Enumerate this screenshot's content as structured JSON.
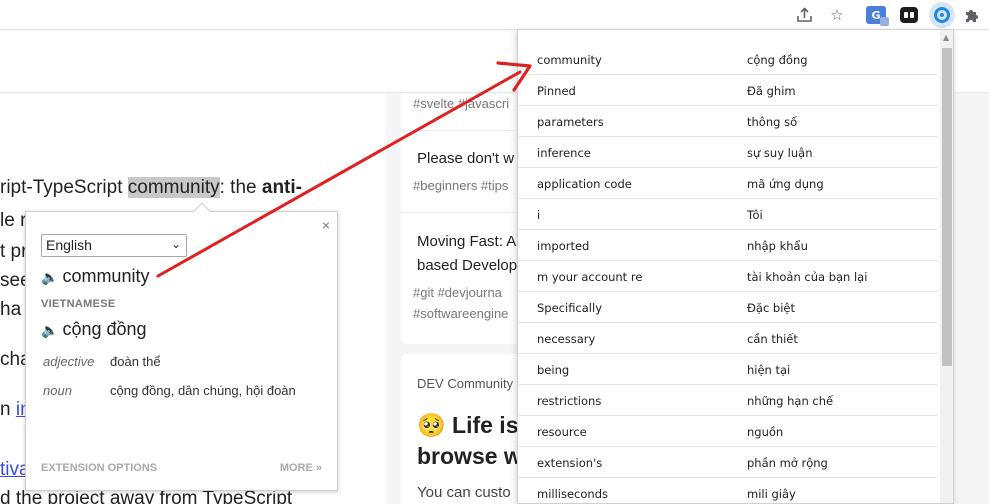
{
  "toolbar": {
    "icons": [
      "share-icon",
      "star-icon",
      "google-translate-icon",
      "extension-icon",
      "vocab-extension-icon",
      "puzzle-icon"
    ]
  },
  "article": {
    "line1": {
      "before": "ript-TypeScript ",
      "highlight": "community",
      "middle": ": the ",
      "bold": "anti-"
    },
    "line2": "le r",
    "line3": "t pr",
    "line4": "see",
    "line5": "ha",
    "line6": "cha",
    "line7_a": "n ",
    "line7_link": "in",
    "line8_link": "tiva",
    "line9": "d the project away from TypeScript"
  },
  "sidebar": {
    "card1_tags": "#svelte #javascri",
    "post1_title": "Please don't w",
    "post1_tags": "#beginners  #tips",
    "post2_title_l1": "Moving Fast: A",
    "post2_title_l2": "based Develop",
    "post2_tags_l1": "#git  #devjourna",
    "post2_tags_l2": "#softwareengine",
    "card2_source": "DEV Community",
    "card2_emoji": "🥺",
    "card2_title_l1": "Life is",
    "card2_title_l2": "browse w",
    "card2_body": "You can custo"
  },
  "dictionary": {
    "close": "×",
    "language": "English",
    "word": "community",
    "target_language": "VIETNAMESE",
    "translation": "cộng đồng",
    "definitions": [
      {
        "pos": "adjective",
        "meaning": "đoàn thể"
      },
      {
        "pos": "noun",
        "meaning": "cộng đồng, dân chúng, hội đoàn"
      }
    ],
    "extension_options": "EXTENSION OPTIONS",
    "more": "MORE »"
  },
  "word_list": [
    {
      "word": "community",
      "translation": "cộng đồng"
    },
    {
      "word": "Pinned",
      "translation": "Đã ghim"
    },
    {
      "word": "parameters",
      "translation": "thông số"
    },
    {
      "word": "inference",
      "translation": "sự suy luận"
    },
    {
      "word": "application code",
      "translation": "mã ứng dụng"
    },
    {
      "word": "i",
      "translation": "Tôi"
    },
    {
      "word": "imported",
      "translation": "nhập khẩu"
    },
    {
      "word": "m your account re",
      "translation": "tài khoản của bạn lại"
    },
    {
      "word": "Specifically",
      "translation": "Đặc biệt"
    },
    {
      "word": "necessary",
      "translation": "cần thiết"
    },
    {
      "word": "being",
      "translation": "hiện tại"
    },
    {
      "word": "restrictions",
      "translation": "những hạn chế"
    },
    {
      "word": "resource",
      "translation": "nguồn"
    },
    {
      "word": "extension's",
      "translation": "phần mở rộng"
    },
    {
      "word": "milliseconds",
      "translation": "mili giây"
    }
  ],
  "colors": {
    "arrow": "#e02020",
    "accent": "#1abc9c",
    "link": "#3b49df",
    "active_extension_bg": "#d8e4f8"
  }
}
